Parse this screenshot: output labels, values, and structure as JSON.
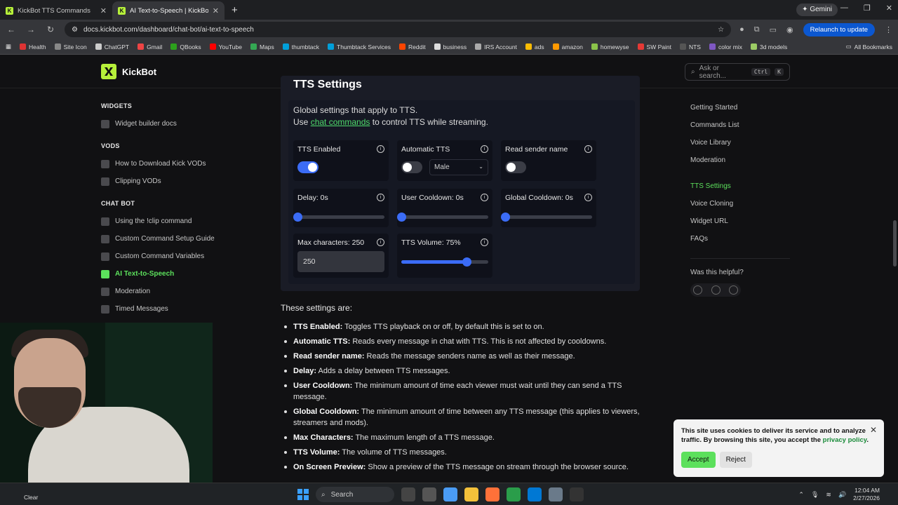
{
  "browser": {
    "tabs": [
      {
        "title": "KickBot TTS Commands",
        "active": false
      },
      {
        "title": "AI Text-to-Speech | KickBot",
        "active": true
      }
    ],
    "gemini_label": "Gemini",
    "url": "docs.kickbot.com/dashboard/chat-bot/ai-text-to-speech",
    "relaunch_label": "Relaunch to update",
    "bookmarks": [
      "Health",
      "Site Icon",
      "ChatGPT",
      "Gmail",
      "QBooks",
      "YouTube",
      "Maps",
      "thumbtack",
      "Thumbtack Services",
      "Reddit",
      "business",
      "IRS Account",
      "ads",
      "amazon",
      "homewyse",
      "SW Paint",
      "NTS",
      "color mix",
      "3d models"
    ],
    "all_bookmarks_label": "All Bookmarks"
  },
  "site": {
    "brand": "KickBot",
    "search_placeholder": "Ask or search...",
    "search_shortcut_1": "Ctrl",
    "search_shortcut_2": "K"
  },
  "sidebar": {
    "sections": [
      {
        "title": "WIDGETS",
        "items": [
          {
            "label": "Widget builder docs"
          }
        ]
      },
      {
        "title": "VODS",
        "items": [
          {
            "label": "How to Download Kick VODs"
          },
          {
            "label": "Clipping VODs"
          }
        ]
      },
      {
        "title": "CHAT BOT",
        "items": [
          {
            "label": "Using the !clip command"
          },
          {
            "label": "Custom Command Setup Guide"
          },
          {
            "label": "Custom Command Variables"
          },
          {
            "label": "AI Text-to-Speech",
            "active": true
          },
          {
            "label": "Moderation"
          },
          {
            "label": "Timed Messages"
          }
        ]
      }
    ]
  },
  "tts_card": {
    "title": "TTS Settings",
    "intro_line1": "Global settings that apply to TTS.",
    "intro_use": "Use",
    "intro_link": "chat commands",
    "intro_rest": "to control TTS while streaming.",
    "tts_enabled": {
      "label": "TTS Enabled",
      "on": true
    },
    "automatic_tts": {
      "label": "Automatic TTS",
      "on": false,
      "voice": "Male"
    },
    "read_sender": {
      "label": "Read sender name",
      "on": false
    },
    "delay": {
      "label": "Delay: 0s",
      "level": 0
    },
    "user_cooldown": {
      "label": "User Cooldown: 0s",
      "level": 0
    },
    "global_cooldown": {
      "label": "Global Cooldown: 0s",
      "level": 0
    },
    "max_chars": {
      "label": "Max characters: 250",
      "value": "250"
    },
    "tts_volume": {
      "label": "TTS Volume: 75%",
      "level": 0.75
    }
  },
  "settings_list": {
    "heading": "These settings are:",
    "items": [
      {
        "term": "TTS Enabled:",
        "desc": "Toggles TTS playback on or off, by default this is set to on."
      },
      {
        "term": "Automatic TTS:",
        "desc": "Reads every message in chat with TTS. This is not affected by cooldowns."
      },
      {
        "term": "Read sender name:",
        "desc": "Reads the message senders name as well as their message."
      },
      {
        "term": "Delay:",
        "desc": "Adds a delay between TTS messages."
      },
      {
        "term": "User Cooldown:",
        "desc": "The minimum amount of time each viewer must wait until they can send a TTS message."
      },
      {
        "term": "Global Cooldown:",
        "desc": "The minimum amount of time between any TTS message (this applies to viewers, streamers and mods)."
      },
      {
        "term": "Max Characters:",
        "desc": "The maximum length of a TTS message."
      },
      {
        "term": "TTS Volume:",
        "desc": "The volume of TTS messages."
      },
      {
        "term": "On Screen Preview:",
        "desc": "Show a preview of the TTS message on stream through the browser source."
      }
    ]
  },
  "toc": {
    "group1": [
      "Getting Started",
      "Commands List",
      "Voice Library",
      "Moderation"
    ],
    "group2": [
      "TTS Settings",
      "Voice Cloning",
      "Widget URL",
      "FAQs"
    ],
    "active": "TTS Settings",
    "helpful": "Was this helpful?"
  },
  "cookie": {
    "message": "This site uses cookies to deliver its service and to analyze traffic. By browsing this site, you accept the",
    "link": "privacy policy",
    "accept": "Accept",
    "reject": "Reject"
  },
  "taskbar": {
    "weather": "Clear",
    "search": "Search",
    "time": "12:04 AM",
    "date": "2/27/2026"
  }
}
